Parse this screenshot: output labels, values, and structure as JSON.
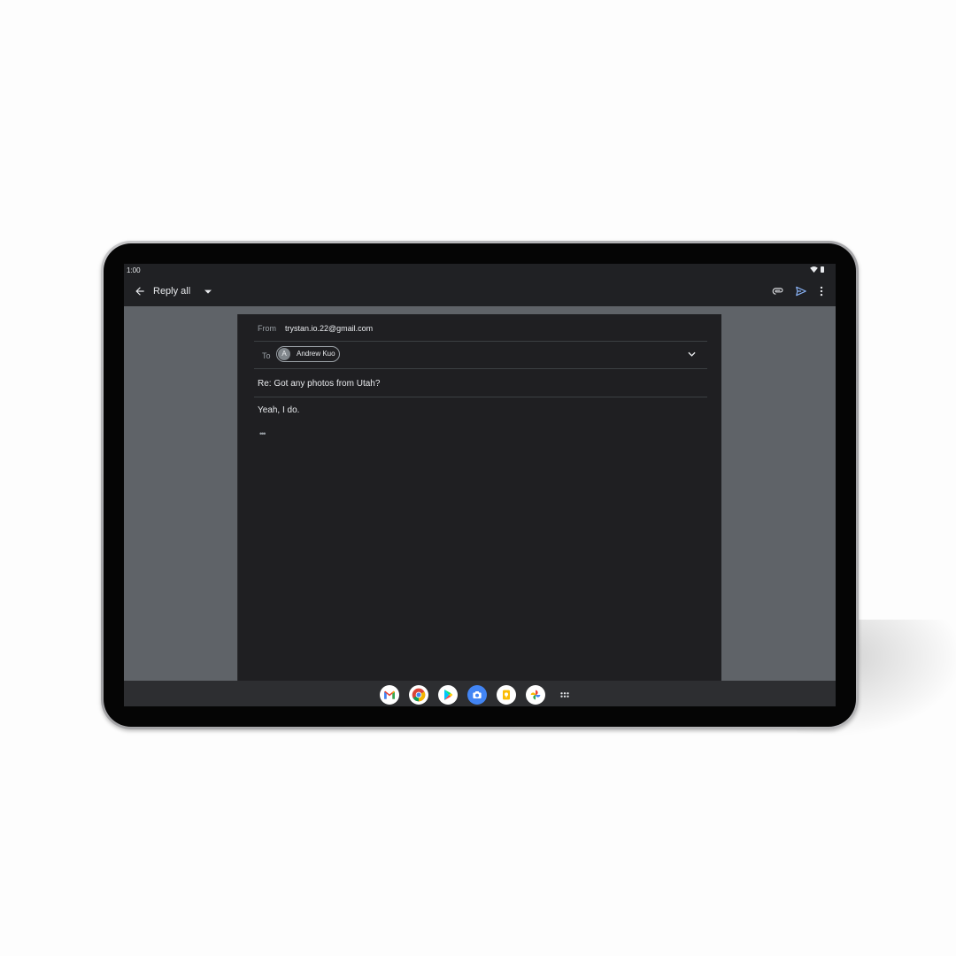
{
  "status_bar": {
    "time": "1:00"
  },
  "app_bar": {
    "title": "Reply all"
  },
  "compose": {
    "from_label": "From",
    "from_value": "trystan.io.22@gmail.com",
    "to_label": "To",
    "recipient": {
      "initial": "A",
      "name": "Andrew Kuo"
    },
    "subject": "Re: Got any photos from Utah?",
    "body": "Yeah, I do.",
    "quoted_text_toggle": "•••"
  },
  "icons": {
    "back": "arrow-back-icon",
    "reply_dropdown": "caret-down-icon",
    "attach": "attachment-icon",
    "send": "send-icon",
    "more": "more-vert-icon",
    "expand_recipients": "chevron-down-icon"
  },
  "dock": {
    "apps": [
      "gmail-icon",
      "chrome-icon",
      "play-store-icon",
      "camera-icon",
      "keep-icon",
      "photos-icon",
      "app-launcher-icon"
    ]
  },
  "colors": {
    "app_background": "#202124",
    "compose_background": "#1f1f22",
    "scrim": "#5f6368",
    "accent": "#8ab4f8"
  }
}
